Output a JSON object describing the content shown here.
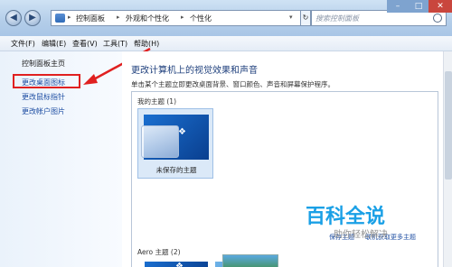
{
  "window": {
    "breadcrumb": [
      "控制面板",
      "外观和个性化",
      "个性化"
    ],
    "search_placeholder": "搜索控制面板"
  },
  "menubar": {
    "items": [
      "文件(F)",
      "编辑(E)",
      "查看(V)",
      "工具(T)",
      "帮助(H)"
    ]
  },
  "sidebar": {
    "items": [
      {
        "label": "控制面板主页"
      },
      {
        "label": "更改桌面图标"
      },
      {
        "label": "更改鼠标指针"
      },
      {
        "label": "更改帐户图片"
      }
    ]
  },
  "main": {
    "heading": "更改计算机上的视觉效果和声音",
    "description": "单击某个主题立即更改桌面背景、窗口颜色、声音和屏幕保护程序。",
    "my_themes_label": "我的主题 (1)",
    "unsaved_theme_label": "未保存的主题",
    "save_theme_link": "保存主题",
    "online_themes_link": "联机获取更多主题",
    "aero_themes_label": "Aero 主题 (2)"
  },
  "annotation": {
    "highlight_color": "#e02020"
  },
  "watermark": {
    "title": "百科全说",
    "subtitle": "助你轻松解决"
  }
}
